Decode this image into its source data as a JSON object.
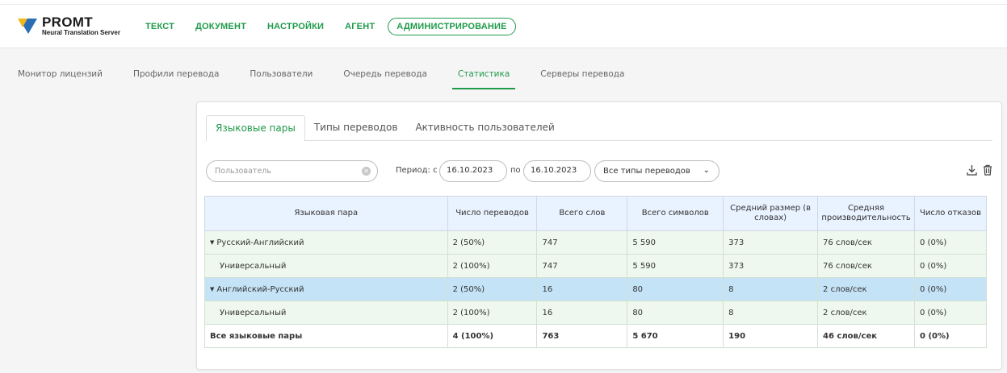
{
  "app": {
    "logo_name": "PROMT",
    "logo_subtitle": "Neural Translation Server",
    "colors": {
      "accent": "#1f9a4a",
      "logo_blue": "#2a6fb6",
      "logo_yellow": "#f2b81c",
      "selected_row": "#c5e3f6",
      "row_bg": "#eef8ee",
      "header_bg": "#e9f2ff"
    }
  },
  "main_nav": {
    "items": [
      {
        "label": "ТЕКСТ"
      },
      {
        "label": "ДОКУМЕНТ"
      },
      {
        "label": "НАСТРОЙКИ"
      },
      {
        "label": "АГЕНТ"
      },
      {
        "label": "АДМИНИСТРИРОВАНИЕ",
        "active": true
      }
    ]
  },
  "sub_nav": {
    "items": [
      {
        "label": "Монитор лицензий"
      },
      {
        "label": "Профили перевода"
      },
      {
        "label": "Пользователи"
      },
      {
        "label": "Очередь перевода"
      },
      {
        "label": "Статистика",
        "active": true
      },
      {
        "label": "Серверы перевода"
      }
    ]
  },
  "tabs": [
    {
      "label": "Языковые пары",
      "active": true
    },
    {
      "label": "Типы переводов"
    },
    {
      "label": "Активность пользователей"
    }
  ],
  "filters": {
    "user_placeholder": "Пользователь",
    "period_label": "Период: с",
    "date_from": "16.10.2023",
    "to_label": "по",
    "date_to": "16.10.2023",
    "type_select": "Все типы переводов",
    "icons": [
      "download-icon",
      "trash-icon"
    ]
  },
  "table": {
    "columns": [
      "Языковая пара",
      "Число переводов",
      "Всего слов",
      "Всего символов",
      "Средний размер (в словах)",
      "Средняя производительность",
      "Число отказов"
    ],
    "rows": [
      {
        "cells": [
          "Русский-Английский",
          "2 (50%)",
          "747",
          "5 590",
          "373",
          "76 слов/сек",
          "0 (0%)"
        ],
        "type": "group",
        "expanded": true
      },
      {
        "cells": [
          "Универсальный",
          "2 (100%)",
          "747",
          "5 590",
          "373",
          "76 слов/сек",
          "0 (0%)"
        ],
        "type": "child"
      },
      {
        "cells": [
          "Английский-Русский",
          "2 (50%)",
          "16",
          "80",
          "8",
          "2 слов/сек",
          "0 (0%)"
        ],
        "type": "group",
        "expanded": true,
        "selected": true
      },
      {
        "cells": [
          "Универсальный",
          "2 (100%)",
          "16",
          "80",
          "8",
          "2 слов/сек",
          "0 (0%)"
        ],
        "type": "child"
      },
      {
        "cells": [
          "Все языковые пары",
          "4 (100%)",
          "763",
          "5 670",
          "190",
          "46 слов/сек",
          "0 (0%)"
        ],
        "type": "total"
      }
    ]
  }
}
